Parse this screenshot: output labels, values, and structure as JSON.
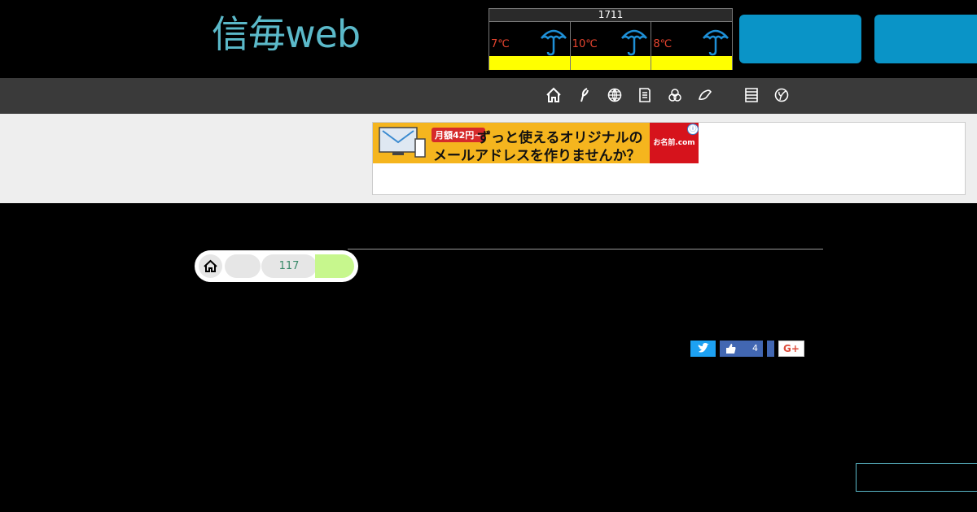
{
  "header": {
    "logo_text": "信毎web",
    "weather": {
      "date": "1711",
      "days": [
        {
          "temp": "7℃",
          "icon": "umbrella-icon"
        },
        {
          "temp": "10℃",
          "icon": "umbrella-icon"
        },
        {
          "temp": "8℃",
          "icon": "umbrella-icon"
        }
      ]
    },
    "buttons": [
      "",
      ""
    ]
  },
  "nav": {
    "icons": [
      "home-icon",
      "leaf-icon",
      "globe-icon",
      "document-icon",
      "atom-icon",
      "shoe-icon",
      "film-icon",
      "sprout-icon"
    ]
  },
  "ad": {
    "price": "月額42円~",
    "line1": "ずっと使えるオリジナルの",
    "line2": "メールアドレスを作りませんか？",
    "logo": "お名前.com",
    "info": "ⓘ"
  },
  "breadcrumb": {
    "count": "117"
  },
  "share": {
    "like_count": "4",
    "gplus": "G+"
  },
  "colors": {
    "accent": "#0a94c7",
    "logo": "#5bb9c9",
    "temp": "#e8452f",
    "weather_bar": "#ffff00"
  }
}
